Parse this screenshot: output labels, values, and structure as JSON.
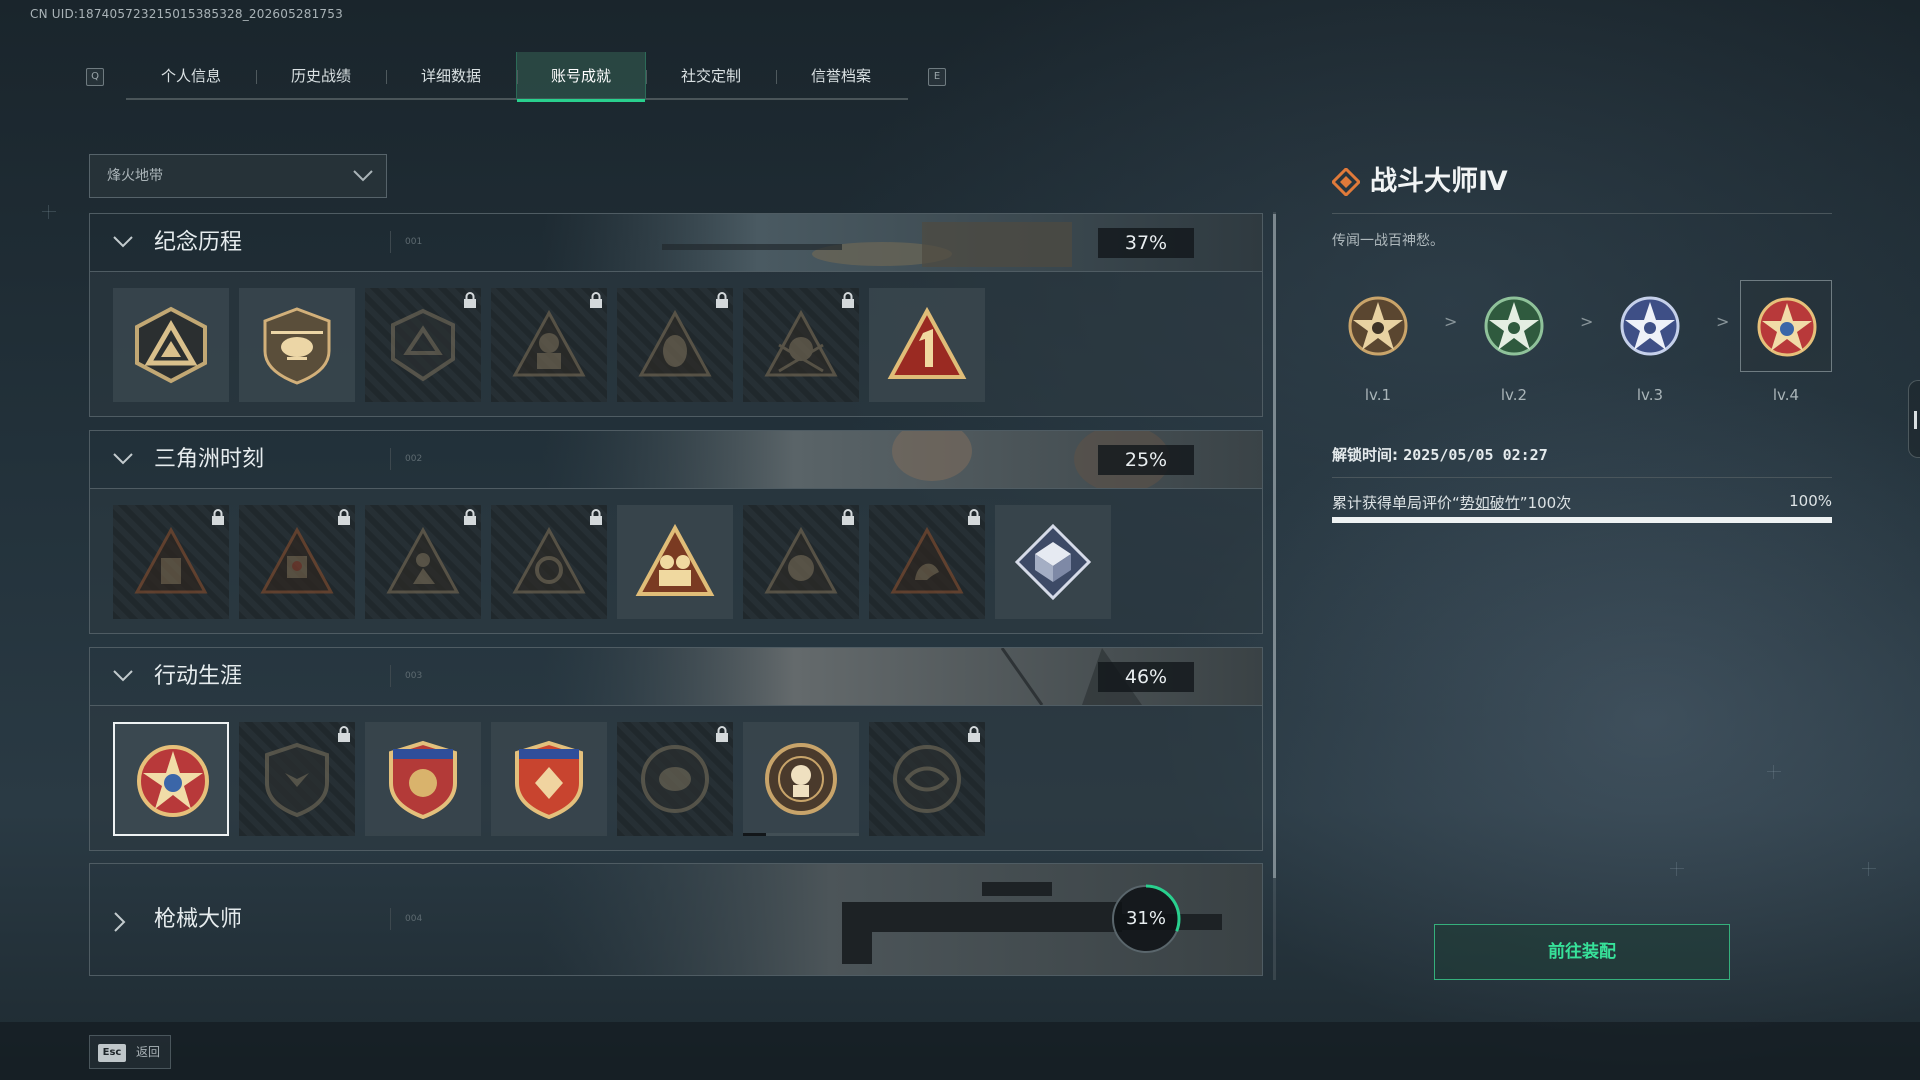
{
  "uid_text": "CN UID:187405723215015385328_202605281753",
  "tab_bar": {
    "left_key": "Q",
    "right_key": "E",
    "tabs": [
      {
        "label": "个人信息"
      },
      {
        "label": "历史战绩"
      },
      {
        "label": "详细数据"
      },
      {
        "label": "账号成就",
        "active": true
      },
      {
        "label": "社交定制"
      },
      {
        "label": "信誉档案"
      }
    ]
  },
  "map_select": {
    "value": "烽火地带",
    "icon": "chevron-down-icon"
  },
  "categories": [
    {
      "name": "纪念历程",
      "index": "001",
      "percent": "37%",
      "expanded": true,
      "badges": [
        {
          "icon": "triangle-emblem-icon",
          "locked": false
        },
        {
          "icon": "helicopter-emblem-icon",
          "locked": false
        },
        {
          "icon": "shield-emblem-icon",
          "locked": true
        },
        {
          "icon": "soldier-emblem-icon",
          "locked": true
        },
        {
          "icon": "masked-face-emblem-icon",
          "locked": true
        },
        {
          "icon": "skull-emblem-icon",
          "locked": true
        },
        {
          "icon": "number-one-emblem-icon",
          "locked": false
        }
      ]
    },
    {
      "name": "三角洲时刻",
      "index": "002",
      "percent": "25%",
      "expanded": true,
      "badges": [
        {
          "icon": "backpack-emblem-icon",
          "locked": true
        },
        {
          "icon": "robot-emblem-icon",
          "locked": true
        },
        {
          "icon": "crouching-soldier-emblem-icon",
          "locked": true
        },
        {
          "icon": "radiation-emblem-icon",
          "locked": true
        },
        {
          "icon": "squad-emblem-icon",
          "locked": false
        },
        {
          "icon": "lion-emblem-icon",
          "locked": true
        },
        {
          "icon": "wolf-emblem-icon",
          "locked": true
        },
        {
          "icon": "diamond-cube-emblem-icon",
          "locked": false
        }
      ]
    },
    {
      "name": "行动生涯",
      "index": "003",
      "percent": "46%",
      "expanded": true,
      "badges": [
        {
          "icon": "star-medal-emblem-icon",
          "locked": false,
          "selected": true
        },
        {
          "icon": "eagle-shield-emblem-icon",
          "locked": true
        },
        {
          "icon": "star-shield-emblem-icon",
          "locked": false
        },
        {
          "icon": "diamond-shield-emblem-icon",
          "locked": false
        },
        {
          "icon": "helmet-emblem-icon",
          "locked": true
        },
        {
          "icon": "target-soldier-emblem-icon",
          "locked": false,
          "progress": 0.2
        },
        {
          "icon": "eye-emblem-icon",
          "locked": true
        }
      ]
    },
    {
      "name": "枪械大师",
      "index": "004",
      "percent": "31%",
      "progress": 0.31,
      "expanded": false
    }
  ],
  "detail": {
    "title": "战斗大师Ⅳ",
    "title_icon": "diamond-rank-icon",
    "description": "传闻一战百神愁。",
    "levels": [
      {
        "label": "lv.1",
        "color": "#c9a46a"
      },
      {
        "label": "lv.2",
        "color": "#5f9a6e"
      },
      {
        "label": "lv.3",
        "color": "#8a9fd0"
      },
      {
        "label": "lv.4",
        "color": "#c8443a",
        "current": true
      }
    ],
    "arrow": ">",
    "unlock_label": "解锁时间:",
    "unlock_time": "2025/05/05 02:27",
    "requirement_prefix": "累计获得单局评价“",
    "requirement_link": "势如破竹",
    "requirement_suffix": "”100次",
    "requirement_percent": "100%",
    "requirement_progress": 1.0
  },
  "equip_button": "前往装配",
  "esc": {
    "key": "Esc",
    "label": "返回"
  },
  "colors": {
    "accent": "#29d08e",
    "button_text": "#37e29a",
    "title_icon": "#e07a3a"
  }
}
